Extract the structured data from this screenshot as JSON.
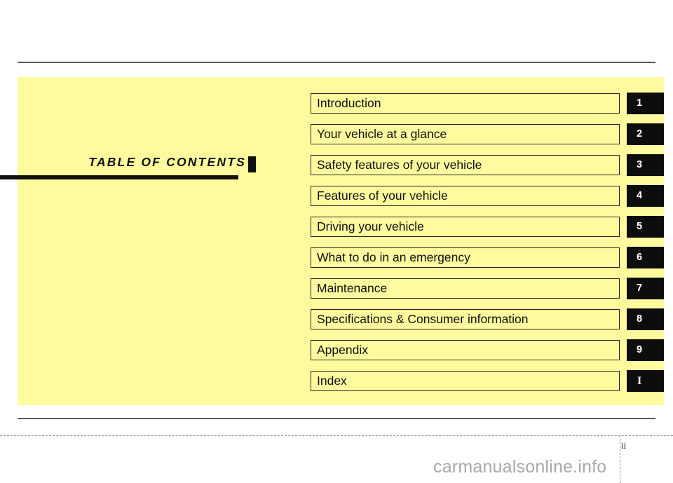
{
  "document": {
    "section_title": "TABLE OF CONTENTS",
    "page_number": "ii",
    "watermark": "carmanualsonline.info",
    "panel_color": "#FDFB9D",
    "tab_color": "#0D0D0D",
    "rule_color": "#595959"
  },
  "toc": {
    "entries": [
      {
        "label": "Introduction",
        "tab": "1"
      },
      {
        "label": "Your vehicle at a glance",
        "tab": "2"
      },
      {
        "label": "Safety features of your vehicle",
        "tab": "3"
      },
      {
        "label": "Features of your vehicle",
        "tab": "4"
      },
      {
        "label": "Driving your vehicle",
        "tab": "5"
      },
      {
        "label": "What to do in an emergency",
        "tab": "6"
      },
      {
        "label": "Maintenance",
        "tab": "7"
      },
      {
        "label": "Specifications & Consumer information",
        "tab": "8"
      },
      {
        "label": "Appendix",
        "tab": "9"
      },
      {
        "label": "Index",
        "tab": "I"
      }
    ]
  }
}
